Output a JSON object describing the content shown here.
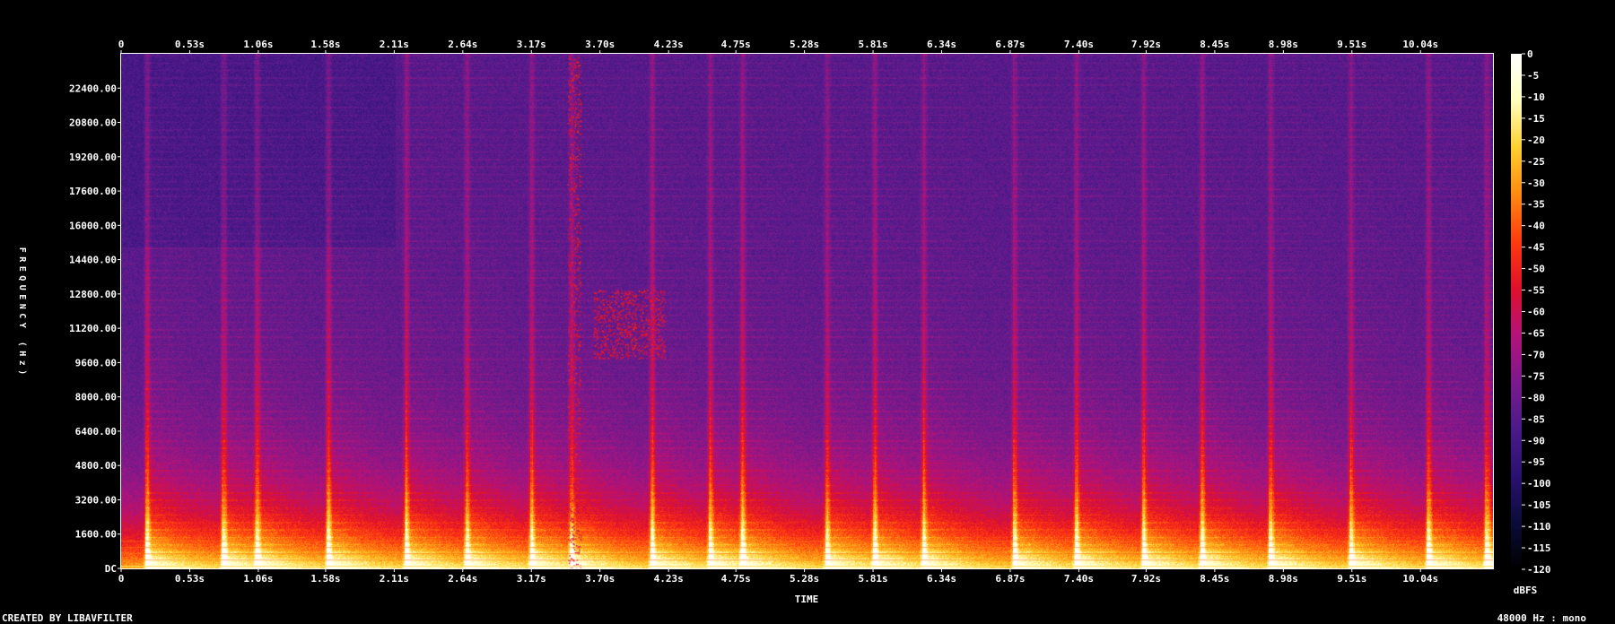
{
  "footer": {
    "left": "CREATED BY LIBAVFILTER",
    "right": "48000 Hz : mono"
  },
  "chart_data": {
    "type": "heatmap",
    "title": "",
    "xlabel": "TIME",
    "ylabel": "FREQUENCY (Hz)",
    "xlim": [
      0,
      10.6
    ],
    "ylim": [
      0,
      24000
    ],
    "x_ticks": [
      "0",
      "0.53s",
      "1.06s",
      "1.58s",
      "2.11s",
      "2.64s",
      "3.17s",
      "3.70s",
      "4.23s",
      "4.75s",
      "5.28s",
      "5.81s",
      "6.34s",
      "6.87s",
      "7.40s",
      "7.92s",
      "8.45s",
      "8.98s",
      "9.51s",
      "10.04s"
    ],
    "x_tick_values": [
      0,
      0.53,
      1.06,
      1.58,
      2.11,
      2.64,
      3.17,
      3.7,
      4.23,
      4.75,
      5.28,
      5.81,
      6.34,
      6.87,
      7.4,
      7.92,
      8.45,
      8.98,
      9.51,
      10.04
    ],
    "y_ticks": [
      "DC",
      "1600.00",
      "3200.00",
      "4800.00",
      "6400.00",
      "8000.00",
      "9600.00",
      "11200.00",
      "12800.00",
      "14400.00",
      "16000.00",
      "17600.00",
      "19200.00",
      "20800.00",
      "22400.00"
    ],
    "y_tick_values": [
      0,
      1600,
      3200,
      4800,
      6400,
      8000,
      9600,
      11200,
      12800,
      14400,
      16000,
      17600,
      19200,
      20800,
      22400
    ],
    "colorbar": {
      "label": "dBFS",
      "range": [
        -120,
        0
      ],
      "ticks": [
        "0",
        "-5",
        "-10",
        "-15",
        "-20",
        "-25",
        "-30",
        "-35",
        "-40",
        "-45",
        "-50",
        "-55",
        "-60",
        "-65",
        "-70",
        "-75",
        "-80",
        "-85",
        "-90",
        "-95",
        "-100",
        "-105",
        "-110",
        "-115",
        "-120"
      ],
      "tick_values": [
        0,
        -5,
        -10,
        -15,
        -20,
        -25,
        -30,
        -35,
        -40,
        -45,
        -50,
        -55,
        -60,
        -65,
        -70,
        -75,
        -80,
        -85,
        -90,
        -95,
        -100,
        -105,
        -110,
        -115,
        -120
      ],
      "colors": [
        "#000000",
        "#0b0b3a",
        "#2a1170",
        "#4b1a8a",
        "#7a1a8c",
        "#b4127a",
        "#e0102a",
        "#ff3a10",
        "#ff8a10",
        "#ffd030",
        "#ffffc0",
        "#ffffff"
      ]
    },
    "background_db": -85,
    "transients_s": [
      0.2,
      0.79,
      1.05,
      1.6,
      2.2,
      2.67,
      3.17,
      3.48,
      4.1,
      4.55,
      4.8,
      5.45,
      5.82,
      6.2,
      6.9,
      7.38,
      7.9,
      8.35,
      8.88,
      9.5,
      10.1,
      10.55
    ],
    "feature_regions": [
      {
        "t_start": 3.65,
        "t_end": 4.2,
        "f_low": 9800,
        "f_high": 13000,
        "db": -55
      },
      {
        "t_start": 3.45,
        "t_end": 3.55,
        "f_low": 0,
        "f_high": 24000,
        "db": -55
      }
    ]
  }
}
